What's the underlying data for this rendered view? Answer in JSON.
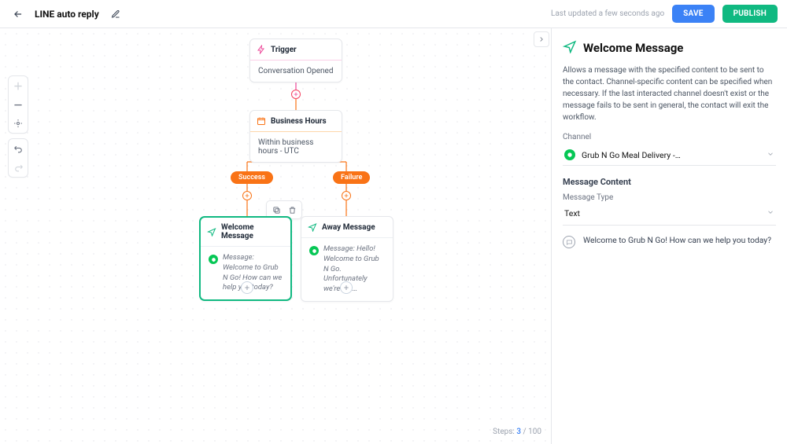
{
  "header": {
    "title": "LINE auto reply",
    "last_updated": "Last updated a few seconds ago",
    "save_label": "SAVE",
    "publish_label": "PUBLISH"
  },
  "canvas": {
    "trigger": {
      "title": "Trigger",
      "body": "Conversation Opened"
    },
    "business_hours": {
      "title": "Business Hours",
      "body": "Within business hours - UTC"
    },
    "chips": {
      "success": "Success",
      "failure": "Failure"
    },
    "welcome": {
      "title": "Welcome Message",
      "prefix": "Message: ",
      "preview": "Welcome to Grub N Go! How can we help  you today?"
    },
    "away": {
      "title": "Away Message",
      "prefix": "Message: ",
      "preview": "Hello! Welcome to Grub N Go. Unfortunately we're not…"
    },
    "steps": {
      "label": "Steps:",
      "current": "3",
      "sep": " / ",
      "total": "100"
    }
  },
  "panel": {
    "title": "Welcome Message",
    "description": "Allows a message with the specified content to be sent to the contact. Channel-specific content can be specified when necessary. If the last interacted channel doesn't exist or the message fails to be sent in general, the contact will exit the workflow.",
    "channel_label": "Channel",
    "channel_value": "Grub N Go Meal Delivery -…",
    "content_label": "Message Content",
    "type_label": "Message Type",
    "type_value": "Text",
    "message_body": "Welcome to Grub N Go! How can we help you today?"
  }
}
